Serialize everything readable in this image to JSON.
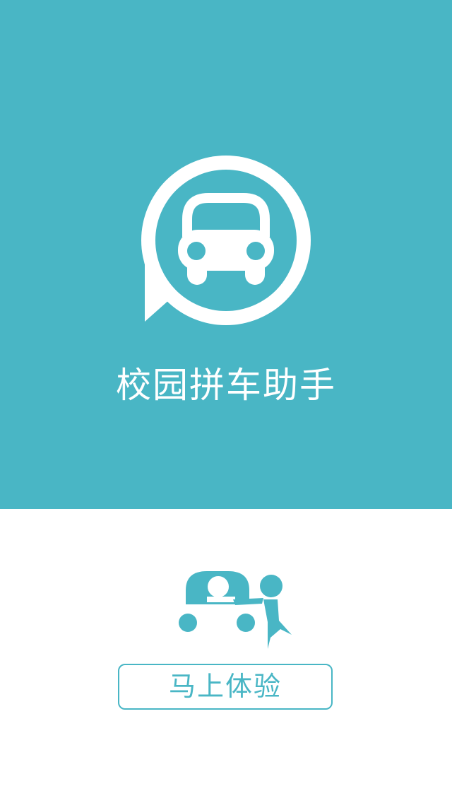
{
  "app": {
    "title": "校园拼车助手"
  },
  "actions": {
    "try_now_label": "马上体验"
  },
  "colors": {
    "accent": "#49b6c5",
    "background": "#ffffff",
    "logo_foreground": "#ffffff"
  },
  "icons": {
    "logo": "car-in-speech-bubble-icon",
    "illustration": "person-pushing-car-icon"
  }
}
